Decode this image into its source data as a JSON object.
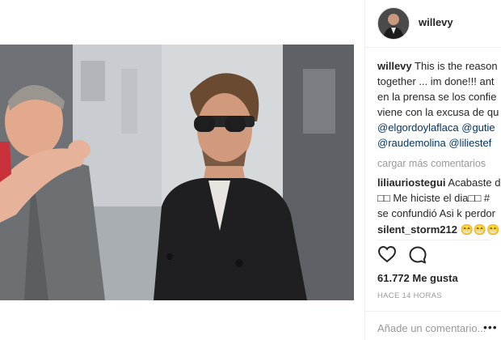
{
  "post": {
    "username": "willevy",
    "caption": {
      "user": "willevy",
      "line1_text": " This is the reason",
      "line2": "together ... im done!!! ant",
      "line3": "en la prensa se los confie",
      "line4": "viene con la excusa de qu",
      "mentions_line1": "@elgordoylaflaca @gutie",
      "mentions_line2": "@raudemolina @liliestef"
    },
    "load_more": "cargar más comentarios",
    "comments": [
      {
        "user": "liliauriostegui",
        "line1_text": " Acabaste d",
        "line2": "□□ Me hiciste el dia□□ #",
        "line3": "se confundió Asi k perdor"
      },
      {
        "user": "silent_storm212",
        "text": " 😁😁😁"
      }
    ],
    "likes": "61.772 Me gusta",
    "timestamp": "HACE 14 HORAS",
    "add_comment_placeholder": "Añade un comentario...",
    "more_label": "•••"
  },
  "icons": {
    "like": "heart-icon",
    "comment": "comment-bubble-icon",
    "more": "more-dots-icon"
  }
}
